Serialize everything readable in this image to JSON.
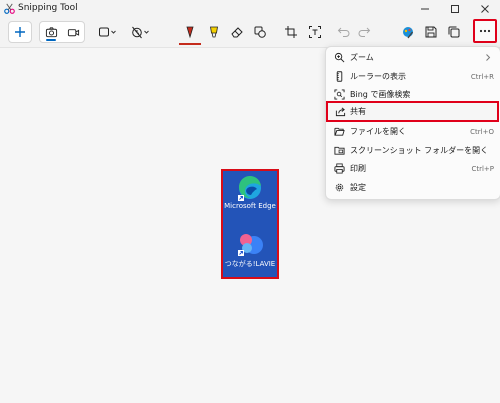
{
  "window": {
    "title": "Snipping Tool",
    "controls": [
      "minimize-icon",
      "maximize-icon",
      "close-icon"
    ]
  },
  "toolbar": {
    "new_icon": "plus-icon",
    "mode_icons": [
      "camera-icon",
      "video-icon"
    ],
    "active_mode": "camera-icon",
    "tools": [
      "rectangle-mode-icon",
      "delay-timer-icon",
      "ballpoint-pen-icon",
      "highlighter-icon",
      "eraser-icon",
      "shapes-icon",
      "crop-icon",
      "text-actions-icon",
      "undo-icon",
      "redo-icon",
      "paint-app-icon",
      "save-icon",
      "copy-icon",
      "more-icon"
    ]
  },
  "menu": {
    "items": [
      {
        "label": "ズーム",
        "icon": "zoom-icon",
        "shortcut": "",
        "submenu": true
      },
      {
        "label": "ルーラーの表示",
        "icon": "ruler-icon",
        "shortcut": "Ctrl+R",
        "submenu": false
      },
      {
        "label": "Bing で画像検索",
        "icon": "visual-search-icon",
        "shortcut": "",
        "submenu": false
      },
      {
        "label": "共有",
        "icon": "share-icon",
        "shortcut": "",
        "submenu": false
      },
      {
        "label": "ファイルを開く",
        "icon": "open-folder-icon",
        "shortcut": "Ctrl+O",
        "submenu": false
      },
      {
        "label": "スクリーンショット フォルダーを開く",
        "icon": "screenshot-folder-icon",
        "shortcut": "",
        "submenu": false
      },
      {
        "label": "印刷",
        "icon": "print-icon",
        "shortcut": "Ctrl+P",
        "submenu": false
      },
      {
        "label": "設定",
        "icon": "settings-icon",
        "shortcut": "",
        "submenu": false
      }
    ],
    "highlighted": "共有"
  },
  "capture": {
    "icons": [
      {
        "label": "Microsoft Edge",
        "icon": "edge-shortcut-icon"
      },
      {
        "label": "つながる!LAVIE",
        "icon": "lavie-shortcut-icon"
      }
    ]
  },
  "colors": {
    "highlight": "#e0001a",
    "accent": "#0067c0",
    "desktop": "#2354b8"
  }
}
